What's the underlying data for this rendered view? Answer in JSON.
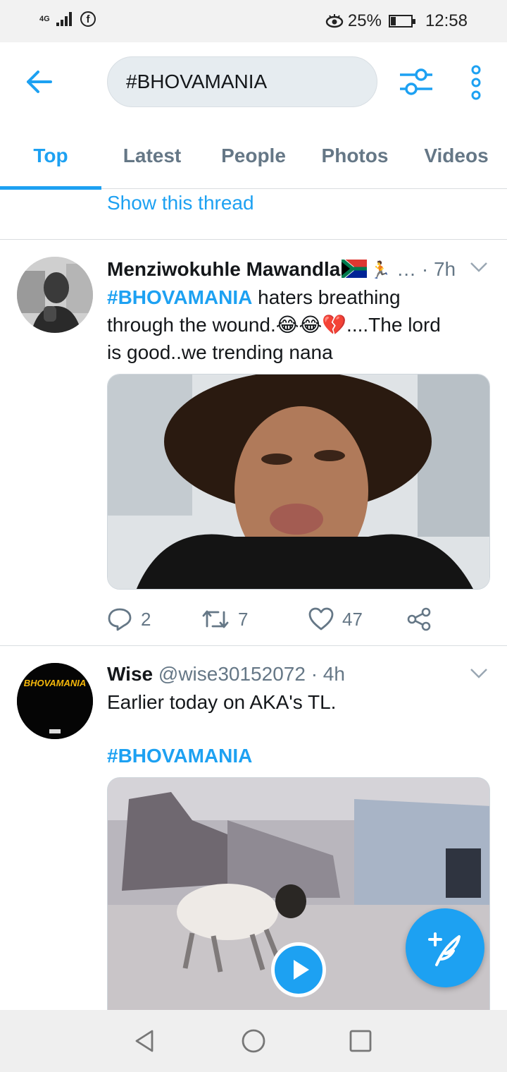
{
  "status_bar": {
    "network": "4G",
    "battery": "25%",
    "battery_level": 0.25,
    "time": "12:58",
    "fb_icon": "f"
  },
  "search": {
    "query": "#BHOVAMANIA"
  },
  "tabs": [
    {
      "label": "Top",
      "active": true
    },
    {
      "label": "Latest",
      "active": false
    },
    {
      "label": "People",
      "active": false
    },
    {
      "label": "Photos",
      "active": false
    },
    {
      "label": "Videos",
      "active": false
    }
  ],
  "feed": {
    "show_thread": "Show this thread",
    "tweets": [
      {
        "name": "Menziwokuhle Mawandla",
        "handle": "…",
        "time": "· 7h",
        "hashtag": "#BHOVAMANIA",
        "text_1": " haters breathing through the wound.",
        "emojis": "😂😂💔",
        "text_2": "....The lord is good..we trending nana",
        "replies": "2",
        "retweets": "7",
        "likes": "47"
      },
      {
        "name": "Wise",
        "handle": "@wise30152072",
        "time": "· 4h",
        "text": "Earlier today on AKA's TL.",
        "hashtag": "#BHOVAMANIA",
        "avatar_text": "BHOVAMANIA"
      }
    ]
  },
  "colors": {
    "accent": "#1da1f2",
    "muted": "#657786",
    "text": "#14171a"
  }
}
